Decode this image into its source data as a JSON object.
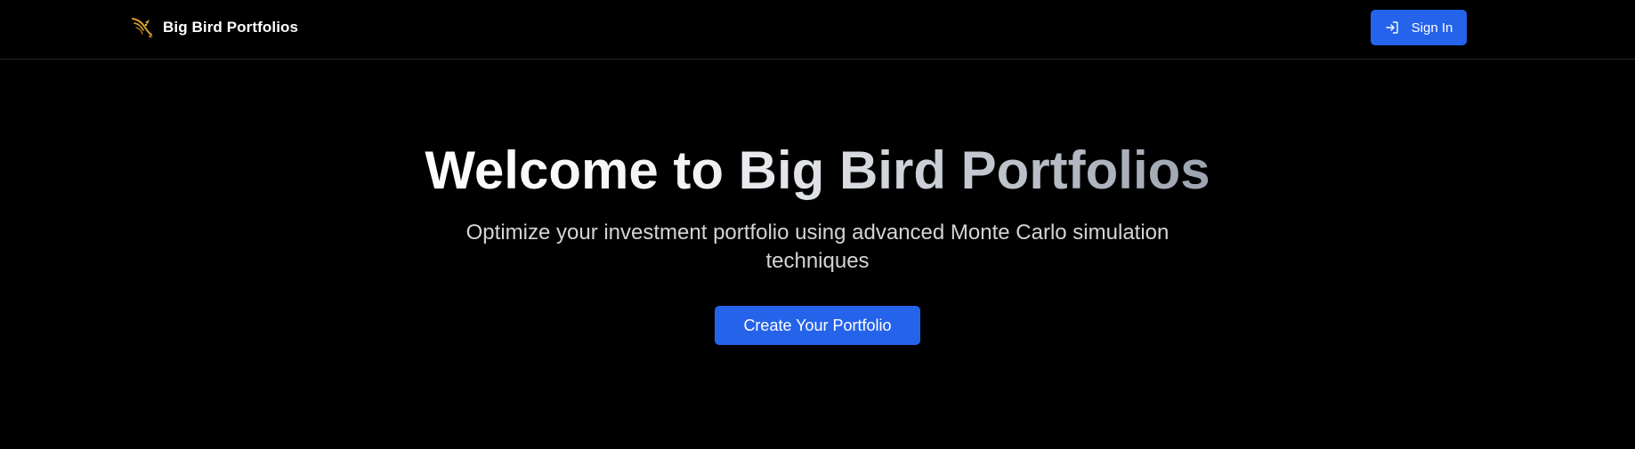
{
  "header": {
    "brand_name": "Big Bird Portfolios",
    "logo_icon": "bird-icon",
    "signin": {
      "icon": "sign-in-icon",
      "label": "Sign In"
    }
  },
  "hero": {
    "title": "Welcome to Big Bird Portfolios",
    "subtitle": "Optimize your investment portfolio using advanced Monte Carlo simulation techniques",
    "cta_label": "Create Your Portfolio"
  },
  "colors": {
    "background": "#000000",
    "accent": "#2563eb",
    "logo": "#d9a02b"
  }
}
